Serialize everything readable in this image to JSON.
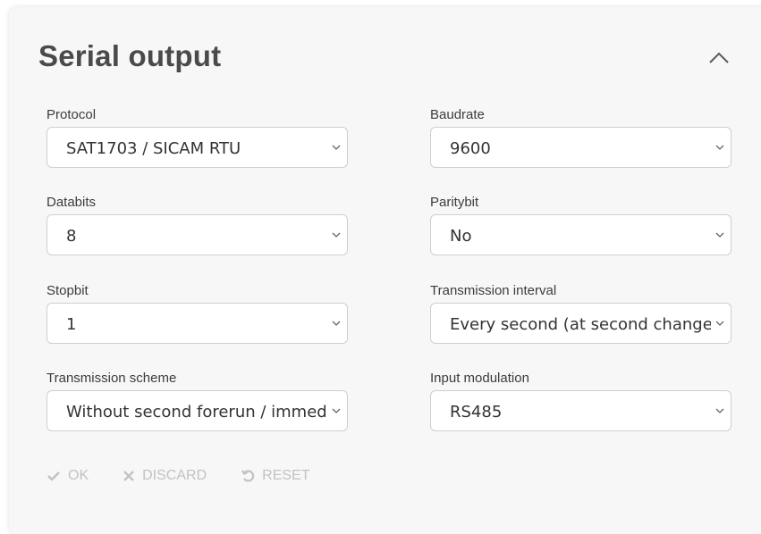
{
  "panel": {
    "title": "Serial output",
    "collapse_icon": "chevron-up-icon"
  },
  "fields": {
    "protocol": {
      "label": "Protocol",
      "value": "SAT1703 / SICAM RTU"
    },
    "baudrate": {
      "label": "Baudrate",
      "value": "9600"
    },
    "databits": {
      "label": "Databits",
      "value": "8"
    },
    "paritybit": {
      "label": "Paritybit",
      "value": "No"
    },
    "stopbit": {
      "label": "Stopbit",
      "value": "1"
    },
    "transmission_interval": {
      "label": "Transmission interval",
      "value": "Every second (at second change)"
    },
    "transmission_scheme": {
      "label": "Transmission scheme",
      "value": "Without second forerun / immediate"
    },
    "input_modulation": {
      "label": "Input modulation",
      "value": "RS485"
    }
  },
  "actions": {
    "ok": {
      "label": "OK",
      "icon": "check-icon"
    },
    "discard": {
      "label": "DISCARD",
      "icon": "close-icon"
    },
    "reset": {
      "label": "RESET",
      "icon": "undo-icon"
    }
  },
  "colors": {
    "panel_bg": "#f7f7f7",
    "title": "#4a4a4a",
    "disabled_action": "#c2c2c2"
  }
}
